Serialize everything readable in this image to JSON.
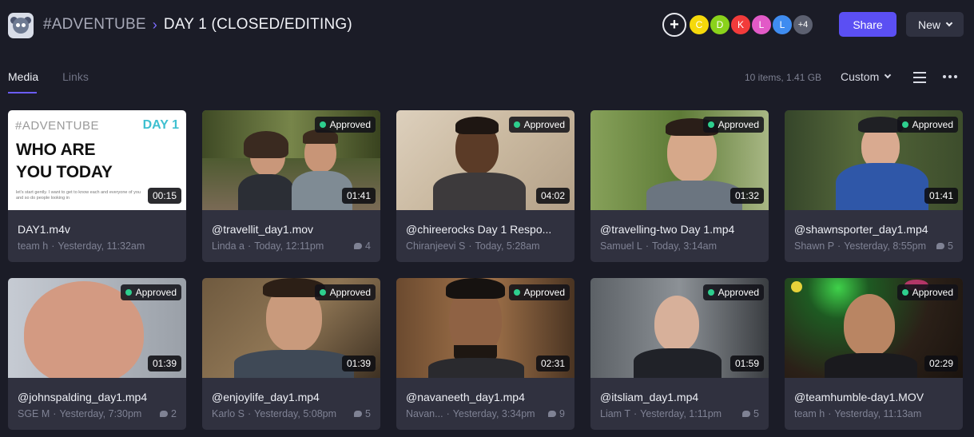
{
  "header": {
    "project": "#ADVENTUBE",
    "separator": ">",
    "folder": "DAY 1 (CLOSED/EDITING)",
    "add_label": "+",
    "avatars": [
      {
        "initial": "C",
        "color": "#f5d90b"
      },
      {
        "initial": "D",
        "color": "#8ad21b"
      },
      {
        "initial": "K",
        "color": "#f23b3b"
      },
      {
        "initial": "L",
        "color": "#e25ac7"
      },
      {
        "initial": "L",
        "color": "#3f8cf0"
      }
    ],
    "more_label": "+4",
    "share_label": "Share",
    "new_label": "New"
  },
  "tabs": [
    {
      "label": "Media",
      "active": true
    },
    {
      "label": "Links",
      "active": false
    }
  ],
  "toolbar": {
    "count": "10 items, 1.41 GB",
    "sort_label": "Custom"
  },
  "title_card": {
    "tag": "#ADVENTUBE",
    "day": "DAY 1",
    "line1": "WHO ARE",
    "line2": "YOU TODAY",
    "small": "let's start gently. I want to get to know each and everyone of you and so do people looking in"
  },
  "status_label": "Approved",
  "items": [
    {
      "name": "DAY1.m4v",
      "who": "team h",
      "when": "Yesterday, 11:32am",
      "comments": "",
      "duration": "00:15",
      "approved": false
    },
    {
      "name": "@travellit_day1.mov",
      "who": "Linda a",
      "when": "Today, 12:11pm",
      "comments": "4",
      "duration": "01:41",
      "approved": true
    },
    {
      "name": "@chireerocks Day 1 Respo...",
      "who": "Chiranjeevi S",
      "when": "Today, 5:28am",
      "comments": "",
      "duration": "04:02",
      "approved": true
    },
    {
      "name": "@travelling-two Day 1.mp4",
      "who": "Samuel L",
      "when": "Today, 3:14am",
      "comments": "",
      "duration": "01:32",
      "approved": true
    },
    {
      "name": "@shawnsporter_day1.mp4",
      "who": "Shawn P",
      "when": "Yesterday, 8:55pm",
      "comments": "5",
      "duration": "01:41",
      "approved": true
    },
    {
      "name": "@johnspalding_day1.mp4",
      "who": "SGE M",
      "when": "Yesterday, 7:30pm",
      "comments": "2",
      "duration": "01:39",
      "approved": true
    },
    {
      "name": "@enjoylife_day1.mp4",
      "who": "Karlo S",
      "when": "Yesterday, 5:08pm",
      "comments": "5",
      "duration": "01:39",
      "approved": true
    },
    {
      "name": "@navaneeth_day1.mp4",
      "who": "Navan...",
      "when": "Yesterday, 3:34pm",
      "comments": "9",
      "duration": "02:31",
      "approved": true
    },
    {
      "name": "@itsliam_day1.mp4",
      "who": "Liam T",
      "when": "Yesterday, 1:11pm",
      "comments": "5",
      "duration": "01:59",
      "approved": true
    },
    {
      "name": "@teamhumble-day1.MOV",
      "who": "team h",
      "when": "Yesterday, 11:13am",
      "comments": "",
      "duration": "02:29",
      "approved": true
    }
  ]
}
